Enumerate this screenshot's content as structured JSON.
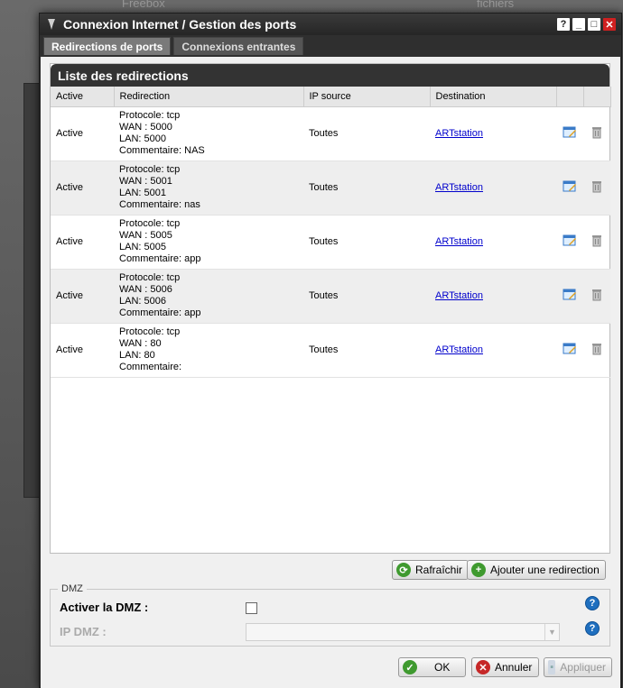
{
  "background": {
    "label_left": "Freebox",
    "label_right": "fichiers"
  },
  "window": {
    "title": "Connexion Internet / Gestion des ports",
    "buttons": [
      "?",
      "_",
      "□",
      "✕"
    ]
  },
  "tabs": [
    {
      "label": "Redirections de ports",
      "active": true
    },
    {
      "label": "Connexions entrantes",
      "active": false
    }
  ],
  "panel": {
    "title": "Liste des redirections",
    "columns": [
      "Active",
      "Redirection",
      "IP source",
      "Destination",
      "",
      ""
    ],
    "rows": [
      {
        "active": "Active",
        "protocol": "Protocole: tcp",
        "wan": "WAN : 5000",
        "lan": "LAN: 5000",
        "comment": "Commentaire: NAS",
        "ip_source": "Toutes",
        "destination": "ARTstation"
      },
      {
        "active": "Active",
        "protocol": "Protocole: tcp",
        "wan": "WAN : 5001",
        "lan": "LAN: 5001",
        "comment": "Commentaire: nas",
        "ip_source": "Toutes",
        "destination": "ARTstation"
      },
      {
        "active": "Active",
        "protocol": "Protocole: tcp",
        "wan": "WAN : 5005",
        "lan": "LAN: 5005",
        "comment": "Commentaire: app",
        "ip_source": "Toutes",
        "destination": "ARTstation"
      },
      {
        "active": "Active",
        "protocol": "Protocole: tcp",
        "wan": "WAN : 5006",
        "lan": "LAN: 5006",
        "comment": "Commentaire: app",
        "ip_source": "Toutes",
        "destination": "ARTstation"
      },
      {
        "active": "Active",
        "protocol": "Protocole: tcp",
        "wan": "WAN : 80",
        "lan": "LAN: 80",
        "comment": "Commentaire:",
        "ip_source": "Toutes",
        "destination": "ARTstation"
      }
    ]
  },
  "actions": {
    "refresh": "Rafraîchir",
    "add": "Ajouter une redirection"
  },
  "dmz": {
    "legend": "DMZ",
    "enable_label": "Activer la DMZ :",
    "enabled": false,
    "ip_label": "IP DMZ :",
    "ip_value": ""
  },
  "footer": {
    "ok": "OK",
    "cancel": "Annuler",
    "apply": "Appliquer"
  },
  "colors": {
    "titlebar": "#262626",
    "link": "#0000cc",
    "help": "#1f6fbf",
    "close": "#d02020"
  }
}
